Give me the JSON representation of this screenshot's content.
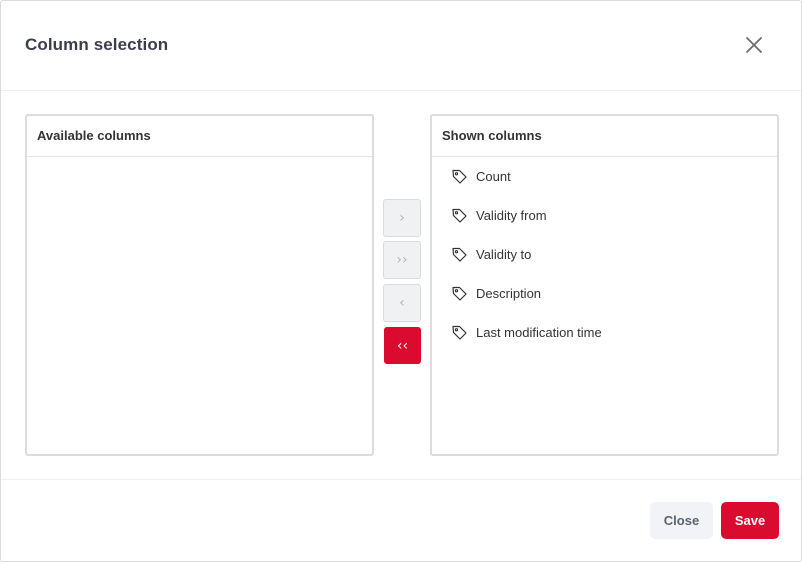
{
  "dialog": {
    "title": "Column selection",
    "close_icon": "close-icon"
  },
  "available": {
    "header": "Available columns",
    "items": []
  },
  "shown": {
    "header": "Shown columns",
    "items": [
      {
        "label": "Count",
        "icon": "tag-icon"
      },
      {
        "label": "Validity from",
        "icon": "tag-icon"
      },
      {
        "label": "Validity to",
        "icon": "tag-icon"
      },
      {
        "label": "Description",
        "icon": "tag-icon"
      },
      {
        "label": "Last modification time",
        "icon": "tag-icon"
      }
    ]
  },
  "move_buttons": {
    "add_one": "›",
    "add_all": "››",
    "remove_one": "‹",
    "remove_all": "‹‹"
  },
  "footer": {
    "close_label": "Close",
    "save_label": "Save"
  },
  "colors": {
    "accent": "#db0a2f",
    "disabled_bg": "#f0f1f3"
  }
}
